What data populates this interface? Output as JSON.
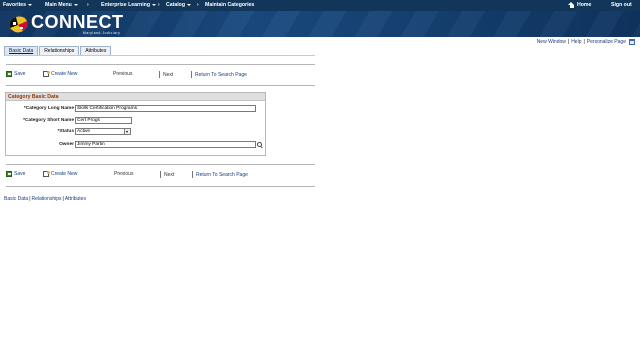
{
  "navbar": {
    "menus": [
      "Favorites",
      "Main Menu"
    ],
    "breadcrumb": [
      "Enterprise Learning",
      "Catalog",
      "Maintain Categories"
    ],
    "home_label": "Home",
    "signout_label": "Sign out"
  },
  "banner": {
    "logo_text": "CONNECT",
    "logo_sub": "Maryland Judiciary"
  },
  "utility": {
    "new_window": "New Window",
    "help": "Help",
    "personalize": "Personalize Page"
  },
  "tabs": [
    "Basic Data",
    "Relationships",
    "Attributes"
  ],
  "toolbar": {
    "save": "Save",
    "create_new": "Create New",
    "previous": "Previous",
    "next": "Next",
    "return": "Return To Search Page"
  },
  "section": {
    "title": "Category Basic Data",
    "fields": {
      "long_name_label": "*Category Long Name",
      "long_name_value": "Skills Certification Programs",
      "short_name_label": "*Category Short Name",
      "short_name_value": "Cert Progs",
      "status_label": "*Status",
      "status_value": "Active",
      "owner_label": "Owner",
      "owner_value": "Jimmy Partin"
    }
  },
  "bottom_links": [
    "Basic Data",
    "Relationships",
    "Attributes"
  ],
  "colors": {
    "navbar": "#12365a",
    "banner": "#1a4a80",
    "link": "#1a3d7c",
    "section_title": "#993300"
  }
}
